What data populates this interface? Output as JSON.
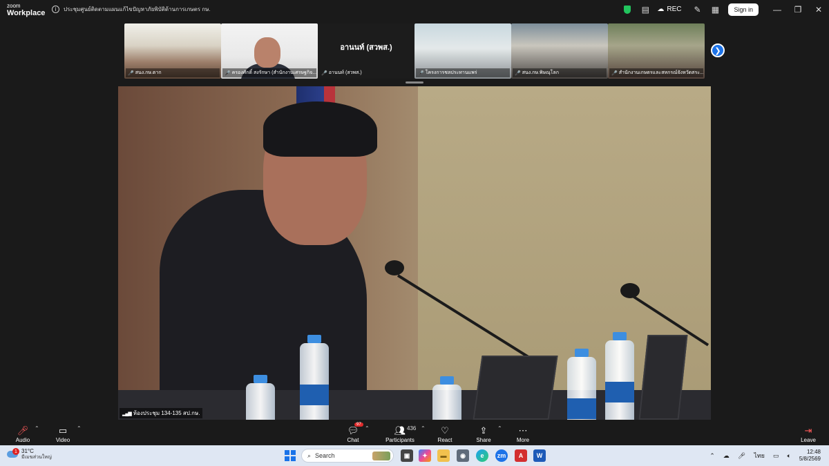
{
  "app": {
    "logo_line1": "zoom",
    "logo_line2": "Workplace"
  },
  "meeting": {
    "title": "ประชุมศูนย์ติดตามแผนแก้ไขปัญหาภัยพิบัติด้านการเกษตร กษ."
  },
  "titlebar": {
    "rec_label": "REC",
    "signin_label": "Sign in"
  },
  "thumbnails": [
    {
      "caption": "สนง.กษ.ตาก"
    },
    {
      "caption": "ครองศักดิ์ สงรักษา (สำนักงานเศรษฐกิจ..."
    },
    {
      "caption": "อานนท์ (สวพส.)",
      "display_name": "อานนท์ (สวพส.)"
    },
    {
      "caption": "โครงการชลประทานแพร่"
    },
    {
      "caption": "สนง.กษ.พิษณุโลก"
    },
    {
      "caption": "สำนักงานเกษตรและสหกรณ์จังหวัดสระ..."
    }
  ],
  "main_video": {
    "caption": "ห้องประชุม 134-135 สป.กษ."
  },
  "toolbar": {
    "audio": "Audio",
    "video": "Video",
    "chat": "Chat",
    "chat_badge": "97",
    "participants": "Participants",
    "participants_count": "436",
    "react": "React",
    "share": "Share",
    "more": "More",
    "leave": "Leave"
  },
  "taskbar": {
    "weather_temp": "31°C",
    "weather_cond": "มีเมฆส่วนใหญ่",
    "weather_badge": "1",
    "search_placeholder": "Search",
    "lang": "ไทย",
    "time": "12:48",
    "date": "5/8/2569"
  },
  "colors": {
    "accent": "#1d73e8",
    "leave": "#e02b2b",
    "rec_shield": "#22c55e"
  }
}
